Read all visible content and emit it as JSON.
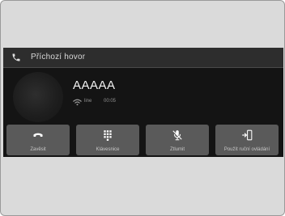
{
  "call": {
    "title": "Příchozí hovor",
    "caller_name": "AAAAA",
    "status_line": "line",
    "status_time": "00:05"
  },
  "actions": [
    {
      "label": "Zavěsit",
      "icon": "hang-up-icon"
    },
    {
      "label": "Klávesnice",
      "icon": "keypad-icon"
    },
    {
      "label": "Ztlumit",
      "icon": "mute-mic-icon"
    },
    {
      "label": "Použít ruční ovládání",
      "icon": "transfer-to-phone-icon"
    }
  ],
  "colors": {
    "title_bar": "#2d2d2d",
    "screen_bg": "#141414",
    "button_bg": "#5a5a5a",
    "outer_bg": "#dadada"
  }
}
